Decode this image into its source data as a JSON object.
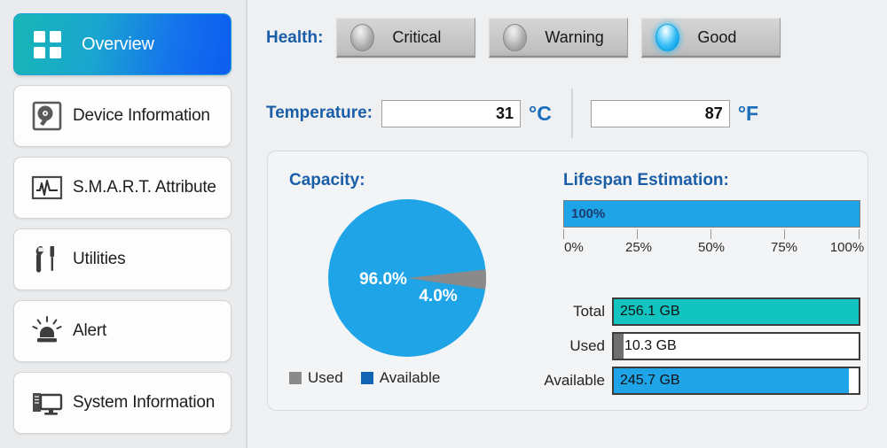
{
  "colors": {
    "accent_blue": "#1a5ea8",
    "led_on": "#2bb6f0",
    "pie_available": "#1fa4e8",
    "pie_used": "#8a8a8a",
    "legend_available": "#1464b4",
    "total_bar": "#12c4c0",
    "used_bar": "#6e6e6e",
    "available_bar": "#1fa4e8",
    "active_nav_gradient_from": "#17b6b6",
    "active_nav_gradient_to": "#0d5cf0"
  },
  "sidebar": {
    "items": [
      {
        "label": "Overview",
        "icon": "grid-icon",
        "active": true
      },
      {
        "label": "Device Information",
        "icon": "hard-drive-icon",
        "active": false
      },
      {
        "label": "S.M.A.R.T. Attribute",
        "icon": "waveform-monitor-icon",
        "active": false
      },
      {
        "label": "Utilities",
        "icon": "wrench-screwdriver-icon",
        "active": false
      },
      {
        "label": "Alert",
        "icon": "siren-icon",
        "active": false
      },
      {
        "label": "System Information",
        "icon": "desktop-computer-icon",
        "active": false
      }
    ]
  },
  "health": {
    "label": "Health:",
    "states": [
      {
        "name": "Critical",
        "lit": false
      },
      {
        "name": "Warning",
        "lit": false
      },
      {
        "name": "Good",
        "lit": true
      }
    ]
  },
  "temperature": {
    "label": "Temperature:",
    "celsius_value": "31",
    "celsius_unit": "°C",
    "fahrenheit_value": "87",
    "fahrenheit_unit": "°F"
  },
  "capacity": {
    "title": "Capacity:",
    "legend": [
      {
        "label": "Used",
        "color": "#8a8a8a"
      },
      {
        "label": "Available",
        "color": "#1464b4"
      }
    ]
  },
  "lifespan": {
    "title": "Lifespan Estimation:",
    "value_label": "100%",
    "percent": 100,
    "ticks": [
      "0%",
      "25%",
      "50%",
      "75%",
      "100%"
    ]
  },
  "capacity_bars": [
    {
      "label": "Total",
      "value": "256.1 GB",
      "percent": 100,
      "color": "#12c4c0"
    },
    {
      "label": "Used",
      "value": "10.3 GB",
      "percent": 4,
      "color": "#6e6e6e"
    },
    {
      "label": "Available",
      "value": "245.7 GB",
      "percent": 96,
      "color": "#1fa4e8"
    }
  ],
  "chart_data": {
    "type": "pie",
    "title": "Capacity:",
    "categories": [
      "Used",
      "Available"
    ],
    "values": [
      4.0,
      96.0
    ],
    "labels": [
      "4.0%",
      "96.0%"
    ],
    "colors": [
      "#8a8a8a",
      "#1fa4e8"
    ],
    "units": "percent",
    "legend_position": "bottom-left",
    "annotations": [
      {
        "text": "96.0%",
        "slice": "Available"
      },
      {
        "text": "4.0%",
        "slice": "Used"
      }
    ]
  }
}
